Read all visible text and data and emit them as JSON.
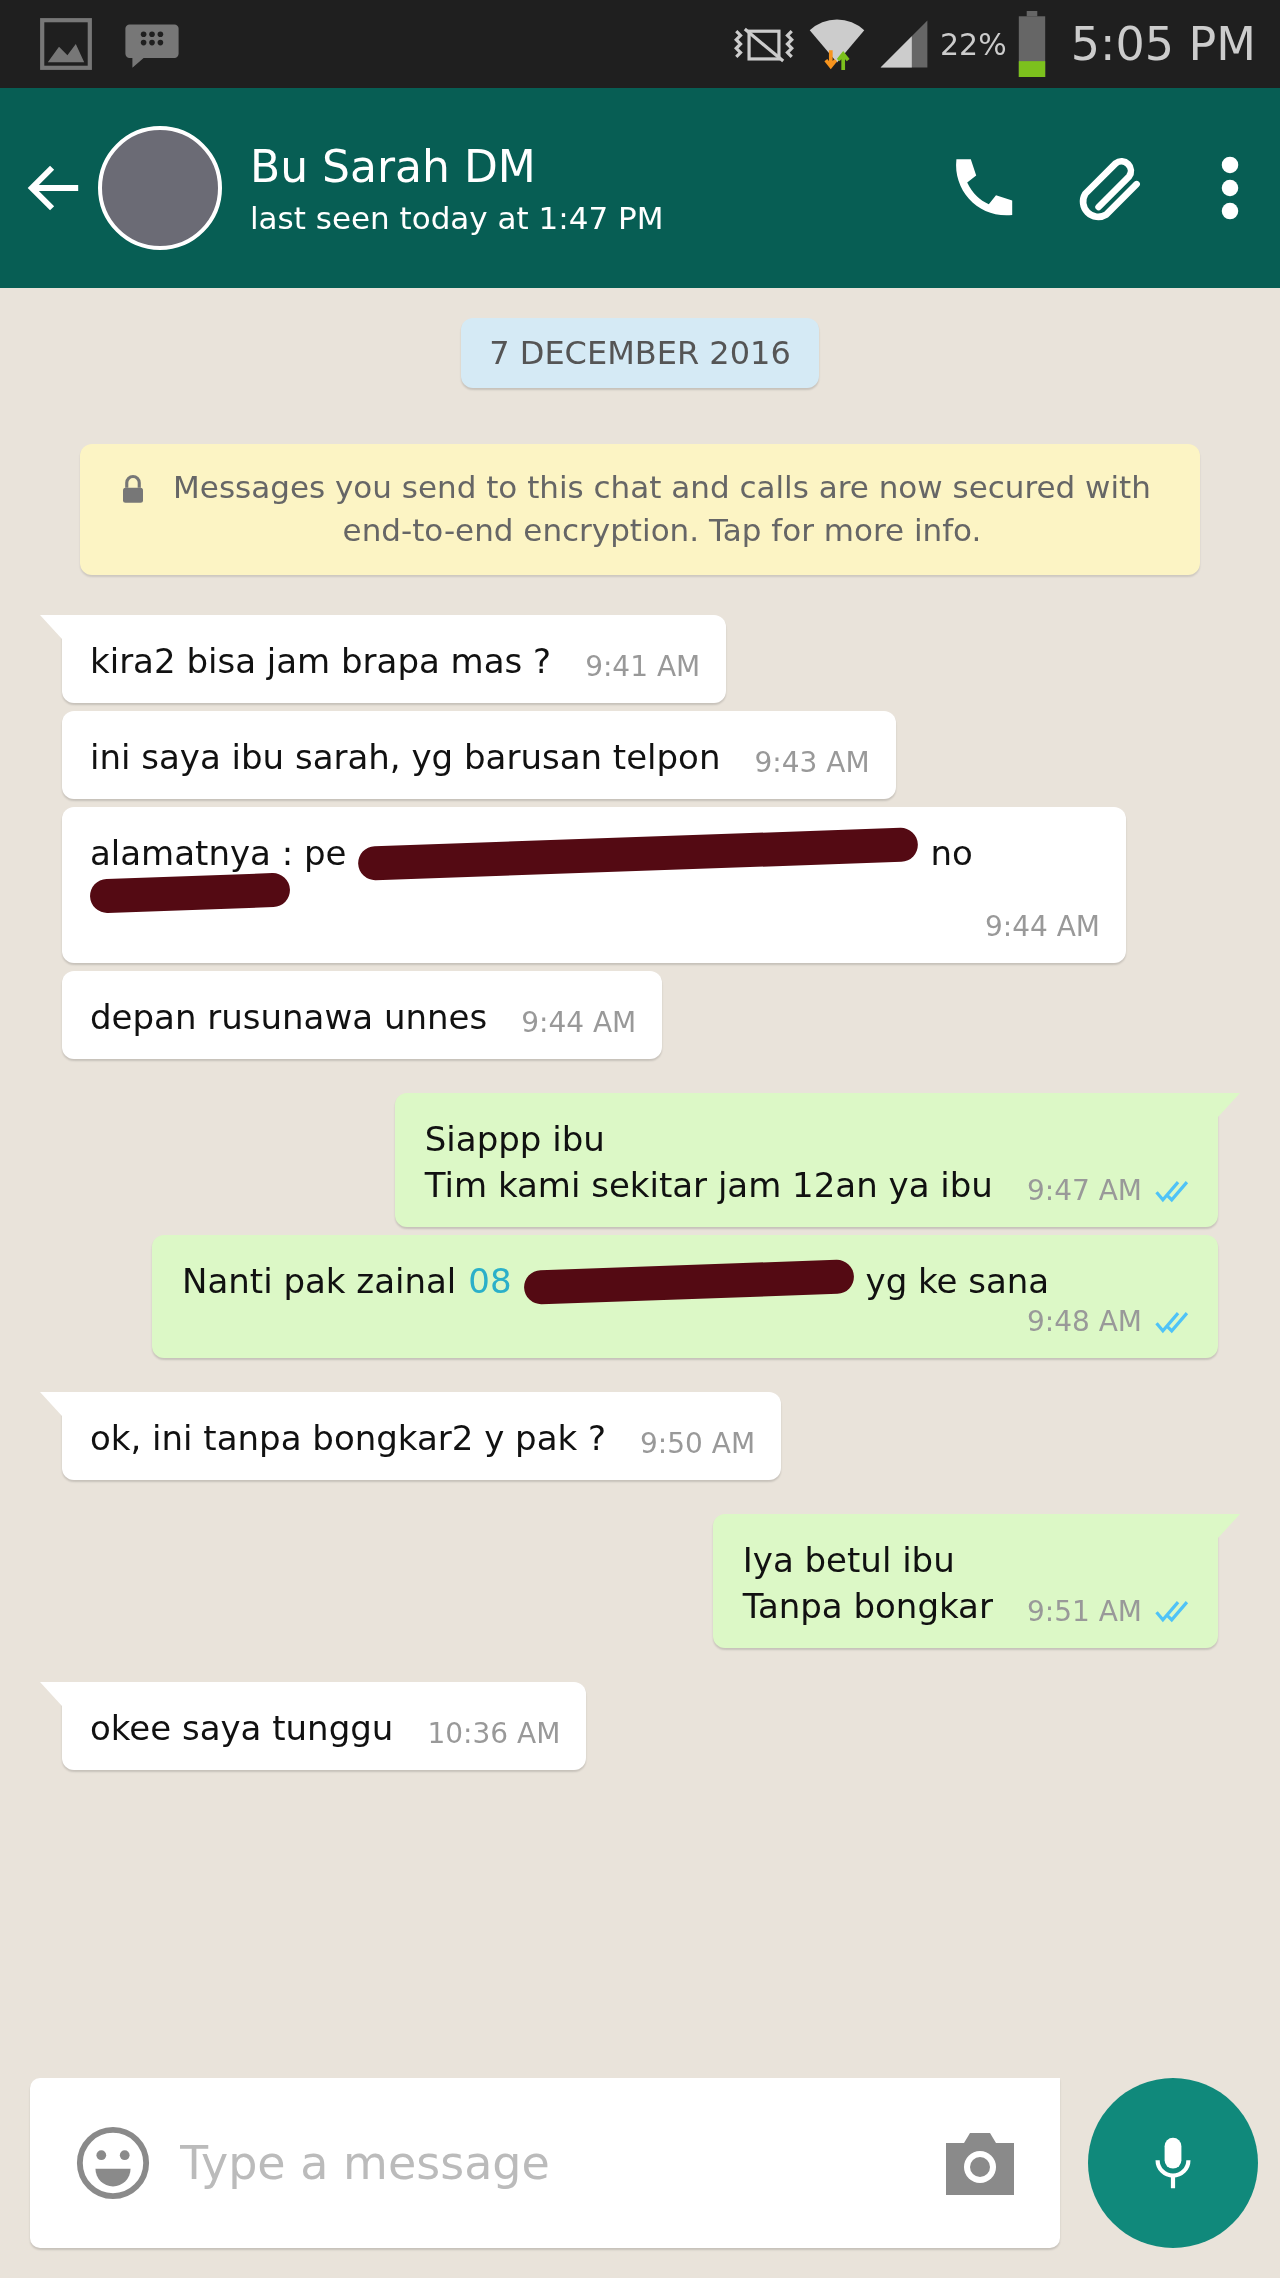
{
  "status_bar": {
    "battery": "22%",
    "time": "5:05 PM"
  },
  "header": {
    "name": "Bu Sarah DM",
    "last_seen": "last seen today at 1:47 PM"
  },
  "date_chip": "7 DECEMBER 2016",
  "encryption_notice": "Messages you send to this chat and calls are now secured with end-to-end encryption. Tap for more info.",
  "messages": [
    {
      "kind": "incoming",
      "tail": true,
      "parts": [
        {
          "kind": "text",
          "text": "kira2 bisa jam brapa mas ?"
        }
      ],
      "time": "9:41 AM"
    },
    {
      "kind": "incoming",
      "tail": false,
      "parts": [
        {
          "kind": "text",
          "text": "ini saya ibu sarah, yg barusan telpon"
        }
      ],
      "time": "9:43 AM"
    },
    {
      "kind": "incoming",
      "tail": false,
      "parts": [
        {
          "kind": "text",
          "text": "alamatnya : pe"
        },
        {
          "kind": "redacted"
        },
        {
          "kind": "text",
          "text": "no"
        },
        {
          "kind": "break"
        },
        {
          "kind": "redacted"
        }
      ],
      "time": "9:44 AM"
    },
    {
      "kind": "incoming",
      "tail": false,
      "parts": [
        {
          "kind": "text",
          "text": "depan rusunawa unnes"
        }
      ],
      "time": "9:44 AM"
    },
    {
      "kind": "outgoing",
      "tail": true,
      "parts": [
        {
          "kind": "text",
          "text": "Siappp ibu"
        },
        {
          "kind": "break"
        },
        {
          "kind": "text",
          "text": "Tim kami sekitar jam 12an ya ibu"
        }
      ],
      "time": "9:47 AM",
      "read": true
    },
    {
      "kind": "outgoing",
      "tail": false,
      "parts": [
        {
          "kind": "text",
          "text": "Nanti pak zainal"
        },
        {
          "kind": "link",
          "text": "08"
        },
        {
          "kind": "redacted"
        },
        {
          "kind": "text",
          "text": "yg ke sana"
        }
      ],
      "time": "9:48 AM",
      "read": true
    },
    {
      "kind": "incoming",
      "tail": true,
      "parts": [
        {
          "kind": "text",
          "text": "ok, ini tanpa bongkar2 y pak ?"
        }
      ],
      "time": "9:50 AM"
    },
    {
      "kind": "outgoing",
      "tail": true,
      "parts": [
        {
          "kind": "text",
          "text": "Iya betul ibu"
        },
        {
          "kind": "break"
        },
        {
          "kind": "text",
          "text": "Tanpa bongkar"
        }
      ],
      "time": "9:51 AM",
      "read": true
    },
    {
      "kind": "incoming",
      "tail": true,
      "parts": [
        {
          "kind": "text",
          "text": "okee saya tunggu"
        }
      ],
      "time": "10:36 AM"
    }
  ],
  "composer": {
    "placeholder": "Type a message"
  }
}
